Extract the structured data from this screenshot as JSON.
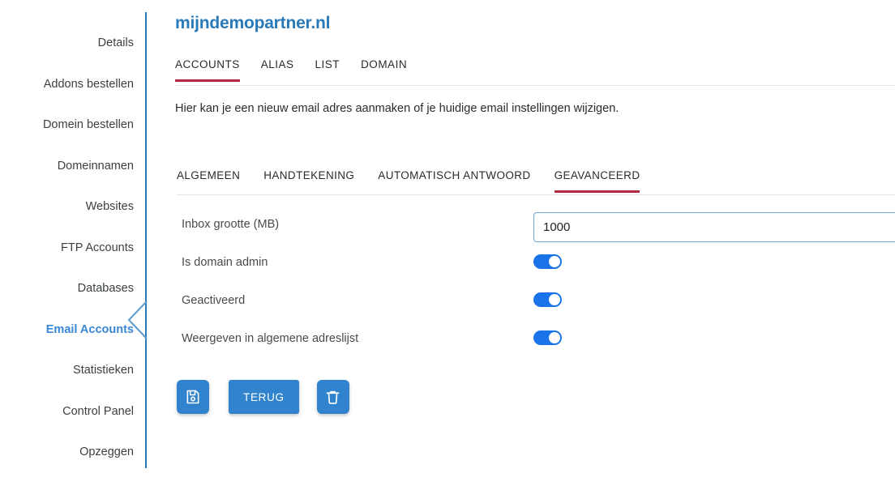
{
  "sidebar": {
    "items": [
      {
        "label": "Details",
        "active": false
      },
      {
        "label": "Addons bestellen",
        "active": false
      },
      {
        "label": "Domein bestellen",
        "active": false
      },
      {
        "label": "Domeinnamen",
        "active": false
      },
      {
        "label": "Websites",
        "active": false
      },
      {
        "label": "FTP Accounts",
        "active": false
      },
      {
        "label": "Databases",
        "active": false
      },
      {
        "label": "Email Accounts",
        "active": true
      },
      {
        "label": "Statistieken",
        "active": false
      },
      {
        "label": "Control Panel",
        "active": false
      },
      {
        "label": "Opzeggen",
        "active": false
      }
    ],
    "active_item": "Email Accounts",
    "rail_color": "#2a7ab9",
    "active_color": "#3a87d5"
  },
  "header": {
    "site_title": "mijndemopartner.nl",
    "title_color": "#2a7ab9"
  },
  "outer_tabs": {
    "active": "ACCOUNTS",
    "underline_color": "#b02a3f",
    "items": [
      {
        "label": "ACCOUNTS"
      },
      {
        "label": "ALIAS"
      },
      {
        "label": "LIST"
      },
      {
        "label": "DOMAIN"
      }
    ]
  },
  "description": "Hier kan je een nieuw email adres aanmaken of je huidige email instellingen wijzigen.",
  "inner_tabs": {
    "active": "GEAVANCEERD",
    "underline_color": "#b02a3f",
    "items": [
      {
        "label": "ALGEMEEN"
      },
      {
        "label": "HANDTEKENING"
      },
      {
        "label": "AUTOMATISCH ANTWOORD"
      },
      {
        "label": "GEAVANCEERD"
      }
    ]
  },
  "form": {
    "inbox_size": {
      "label": "Inbox grootte (MB)",
      "value": "1000",
      "placeholder": ""
    },
    "is_domain_admin": {
      "label": "Is domain admin",
      "value": "on"
    },
    "activated": {
      "label": "Geactiveerd",
      "value": "on"
    },
    "show_in_address_list": {
      "label": "Weergeven in algemene adreslijst",
      "value": "on"
    },
    "toggle_on_color": "#1a73e8"
  },
  "actions": {
    "save": {
      "label": "",
      "icon": "save-floppy-icon"
    },
    "back": {
      "label": "TERUG"
    },
    "delete": {
      "label": "",
      "icon": "trash-icon"
    },
    "button_color": "#3183ce"
  }
}
